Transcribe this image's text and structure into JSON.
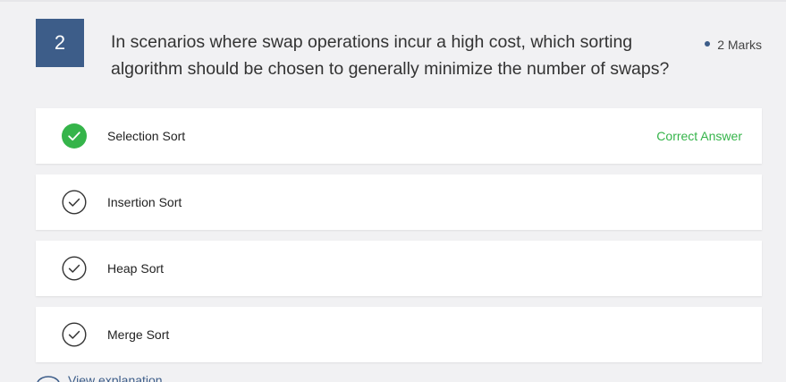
{
  "question": {
    "number": "2",
    "text": "In scenarios where swap operations incur a high cost, which sorting algorithm should be chosen to generally minimize the number of swaps?",
    "marks": "2 Marks"
  },
  "options": [
    {
      "label": "Selection Sort",
      "icon": "check-filled-icon",
      "status": "Correct Answer"
    },
    {
      "label": "Insertion Sort",
      "icon": "check-outline-icon"
    },
    {
      "label": "Heap Sort",
      "icon": "check-outline-icon"
    },
    {
      "label": "Merge Sort",
      "icon": "check-outline-icon"
    }
  ],
  "footer": {
    "link_label": "View explanation"
  },
  "colors": {
    "accent": "#3d5d89",
    "correct": "#35b44a",
    "background": "#f1f1f3"
  }
}
